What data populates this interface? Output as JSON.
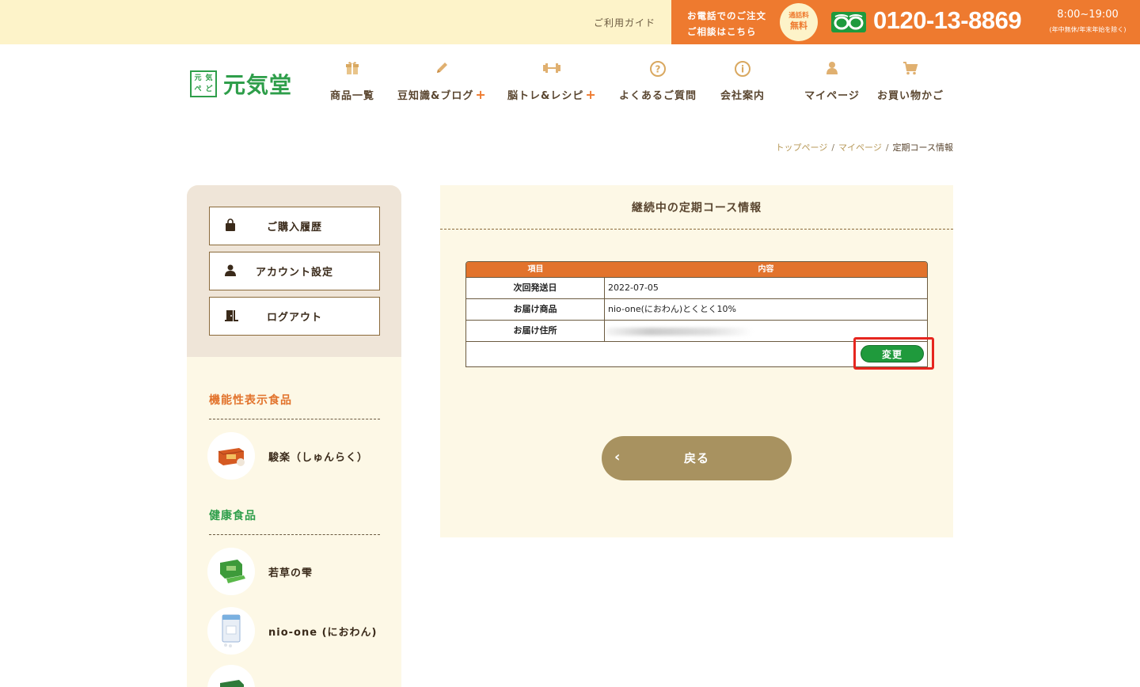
{
  "topbar": {
    "guide": "ご利用ガイド",
    "phone_note_1": "お電話でのご注文",
    "phone_note_2": "ご相談はこちら",
    "free_badge_1": "通話料",
    "free_badge_2": "無料",
    "phone_number": "0120-13-8869",
    "hours": "8:00~19:00",
    "hours_note": "(年中無休/年末年始を除く)"
  },
  "brand": {
    "name": "元気堂",
    "mark": [
      "元",
      "気",
      "ぺ",
      "ど"
    ]
  },
  "nav": {
    "items": [
      {
        "label": "商品一覧",
        "icon": "gift-icon"
      },
      {
        "label": "豆知識&ブログ",
        "icon": "pencil-icon",
        "plus": "+"
      },
      {
        "label": "脳トレ&レシピ",
        "icon": "dumbbell-icon",
        "plus": "+"
      },
      {
        "label": "よくあるご質問",
        "icon": "question-icon"
      },
      {
        "label": "会社案内",
        "icon": "info-icon"
      },
      {
        "label": "マイページ",
        "icon": "user-icon"
      },
      {
        "label": "お買い物かご",
        "icon": "cart-icon"
      }
    ]
  },
  "breadcrumb": {
    "home": "トップページ",
    "mypage": "マイページ",
    "current": "定期コース情報",
    "sep": "/"
  },
  "sidebar": {
    "buttons": [
      {
        "label": "ご購入履歴",
        "icon": "bag-icon"
      },
      {
        "label": "アカウント設定",
        "icon": "user-icon"
      },
      {
        "label": "ログアウト",
        "icon": "door-icon"
      }
    ],
    "cat_functional": "機能性表示食品",
    "cat_health": "健康食品",
    "products": [
      {
        "name": "駿楽（しゅんらく）"
      },
      {
        "name": "若草の雫"
      },
      {
        "name": "nio-one (におわん)"
      }
    ]
  },
  "main": {
    "title": "継続中の定期コース情報",
    "table": {
      "head_item": "項目",
      "head_content": "内容",
      "rows": [
        {
          "label": "次回発送日",
          "value": "2022-07-05"
        },
        {
          "label": "お届け商品",
          "value": "nio-one(におわん)とくとく10%"
        },
        {
          "label": "お届け住所",
          "value": ""
        }
      ]
    },
    "change_label": "変更",
    "back_label": "戻る",
    "back_arrow": "‹"
  },
  "colors": {
    "accent": "#ee7a2f",
    "green": "#2e9e4a",
    "highlight": "#e6261f",
    "back": "#a89260"
  }
}
